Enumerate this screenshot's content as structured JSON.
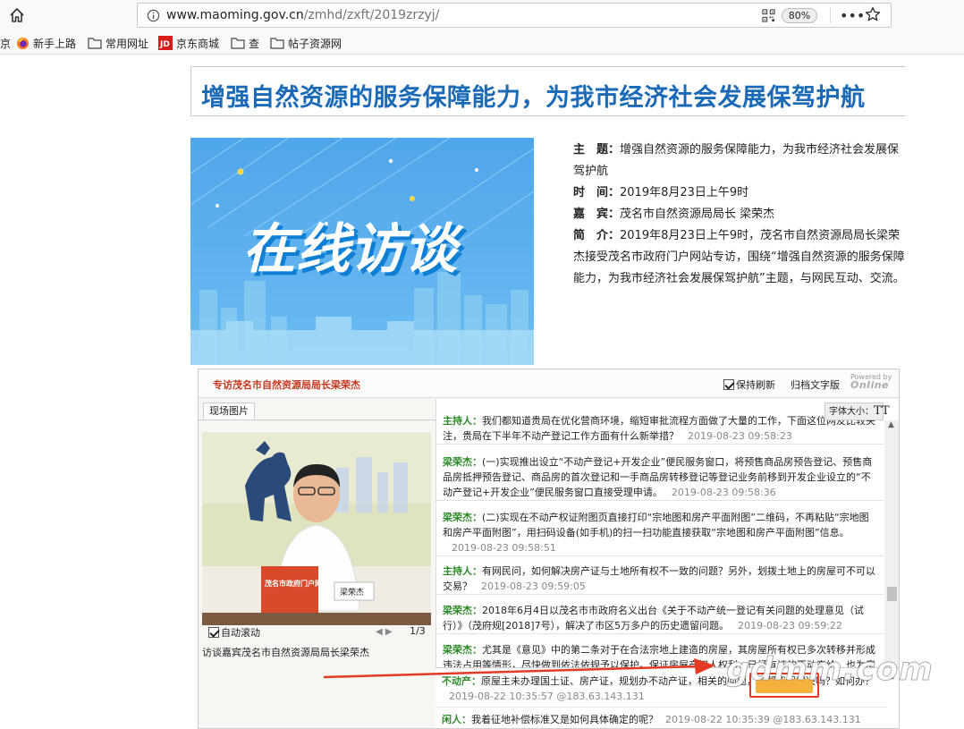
{
  "browser": {
    "url_host": "www.maoming.gov.cn",
    "url_path": "/zmhd/zxft/2019zrzyj/",
    "zoom": "80%",
    "bookmarks": [
      {
        "label": "京",
        "icon": "none"
      },
      {
        "label": "新手上路",
        "icon": "firefox-icon"
      },
      {
        "label": "常用网址",
        "icon": "folder-icon"
      },
      {
        "label": "京东商城",
        "icon": "jd-icon"
      },
      {
        "label": "查",
        "icon": "folder-icon"
      },
      {
        "label": "帖子资源网",
        "icon": "folder-icon"
      }
    ]
  },
  "page": {
    "headline": "增强自然资源的服务保障能力，为我市经济社会发展保驾护航",
    "banner_text": "在线访谈",
    "info": {
      "topic_label": "主　题：",
      "topic": "增强自然资源的服务保障能力，为我市经济社会发展保驾护航",
      "time_label": "时　间：",
      "time": "2019年8月23日上午9时",
      "guest_label": "嘉　宾：",
      "guest": "茂名市自然资源局局长 梁荣杰",
      "intro_label": "简　介：",
      "intro": "2019年8月23日上午9时，茂名市自然资源局局长梁荣杰接受茂名市政府门户网站专访，围绕“增强自然资源的服务保障能力，为我市经济社会发展保驾护航”主题，与网民互动、交流。"
    }
  },
  "widget": {
    "title": "专访茂名市自然资源局局长梁荣杰",
    "keep_refresh": "保持刷新",
    "archive": "归档文字版",
    "logo_small": "Powered by",
    "logo": "Online",
    "photo_tab": "现场图片",
    "auto_scroll": "自动滚动",
    "page_indicator": "1/3",
    "caption": "访谈嘉宾茂名市自然资源局局长梁荣杰",
    "photo_sign": "茂名市政府门户网站",
    "photo_nameplate": "梁荣杰",
    "font_size_label": "字体大小：",
    "font_size_glyph": "TT",
    "messages": [
      {
        "who": "主持人：",
        "text": "我们都知道贵局在优化营商环境，缩短审批流程方面做了大量的工作，下面这位网友比较关注，贵局在下半年不动产登记工作方面有什么新举措？",
        "time": "2019-08-23 09:58:23"
      },
      {
        "who": "梁荣杰：",
        "text": "(一)实现推出设立“不动产登记+开发企业”便民服务窗口，将预售商品房预告登记、预售商品房抵押预告登记、商品房的首次登记和一手商品房转移登记等登记业务前移到开发企业设立的“不动产登记+开发企业”便民服务窗口直接受理申请。",
        "time": "2019-08-23 09:58:36"
      },
      {
        "who": "梁荣杰：",
        "text": "(二)实现在不动产权证附图页直接打印“宗地图和房产平面附图”二维码，不再粘贴“宗地图和房产平面附图”，用扫码设备(如手机)的扫一扫功能直接获取“宗地图和房产平面附图”信息。",
        "time": "2019-08-23 09:58:51"
      },
      {
        "who": "主持人：",
        "text": "有网民问，如何解决房产证与土地所有权不一致的问题？另外，划拨土地上的房屋可不可以交易？",
        "time": "2019-08-23 09:59:05"
      },
      {
        "who": "梁荣杰：",
        "text": "2018年6月4日以茂名市市政府名义出台《关于不动产统一登记有关问题的处理意见（试行）》（茂府规[2018]7号），解决了市区5万多户的历史遗留问题。",
        "time": "2019-08-23 09:59:22"
      },
      {
        "who": "梁荣杰：",
        "text": "尤其是《意见》中的第二条对于在合法宗地上建造的房屋，其房屋所有权已多次转移并形成违法占用等情形，尽快做到依法依规予以保护。保证房屋产权人权利，已经有证的不动产给，也为房屋开发消除障碍。",
        "time": ""
      }
    ],
    "lower_messages": [
      {
        "who": "不动产：",
        "text": "原屋主未办理国土证、房产证，规划办不动产证，相关的问题，能帮我们解决吗？如何办？",
        "time": "2019-08-22 10:35:57 @183.63.143.131"
      },
      {
        "who": "闲人：",
        "text": "我着征地补偿标准又是如何具体确定的呢？",
        "time": "2019-08-22 10:35:39 @183.63.143.131"
      }
    ],
    "watermark": "gdmm.com"
  }
}
